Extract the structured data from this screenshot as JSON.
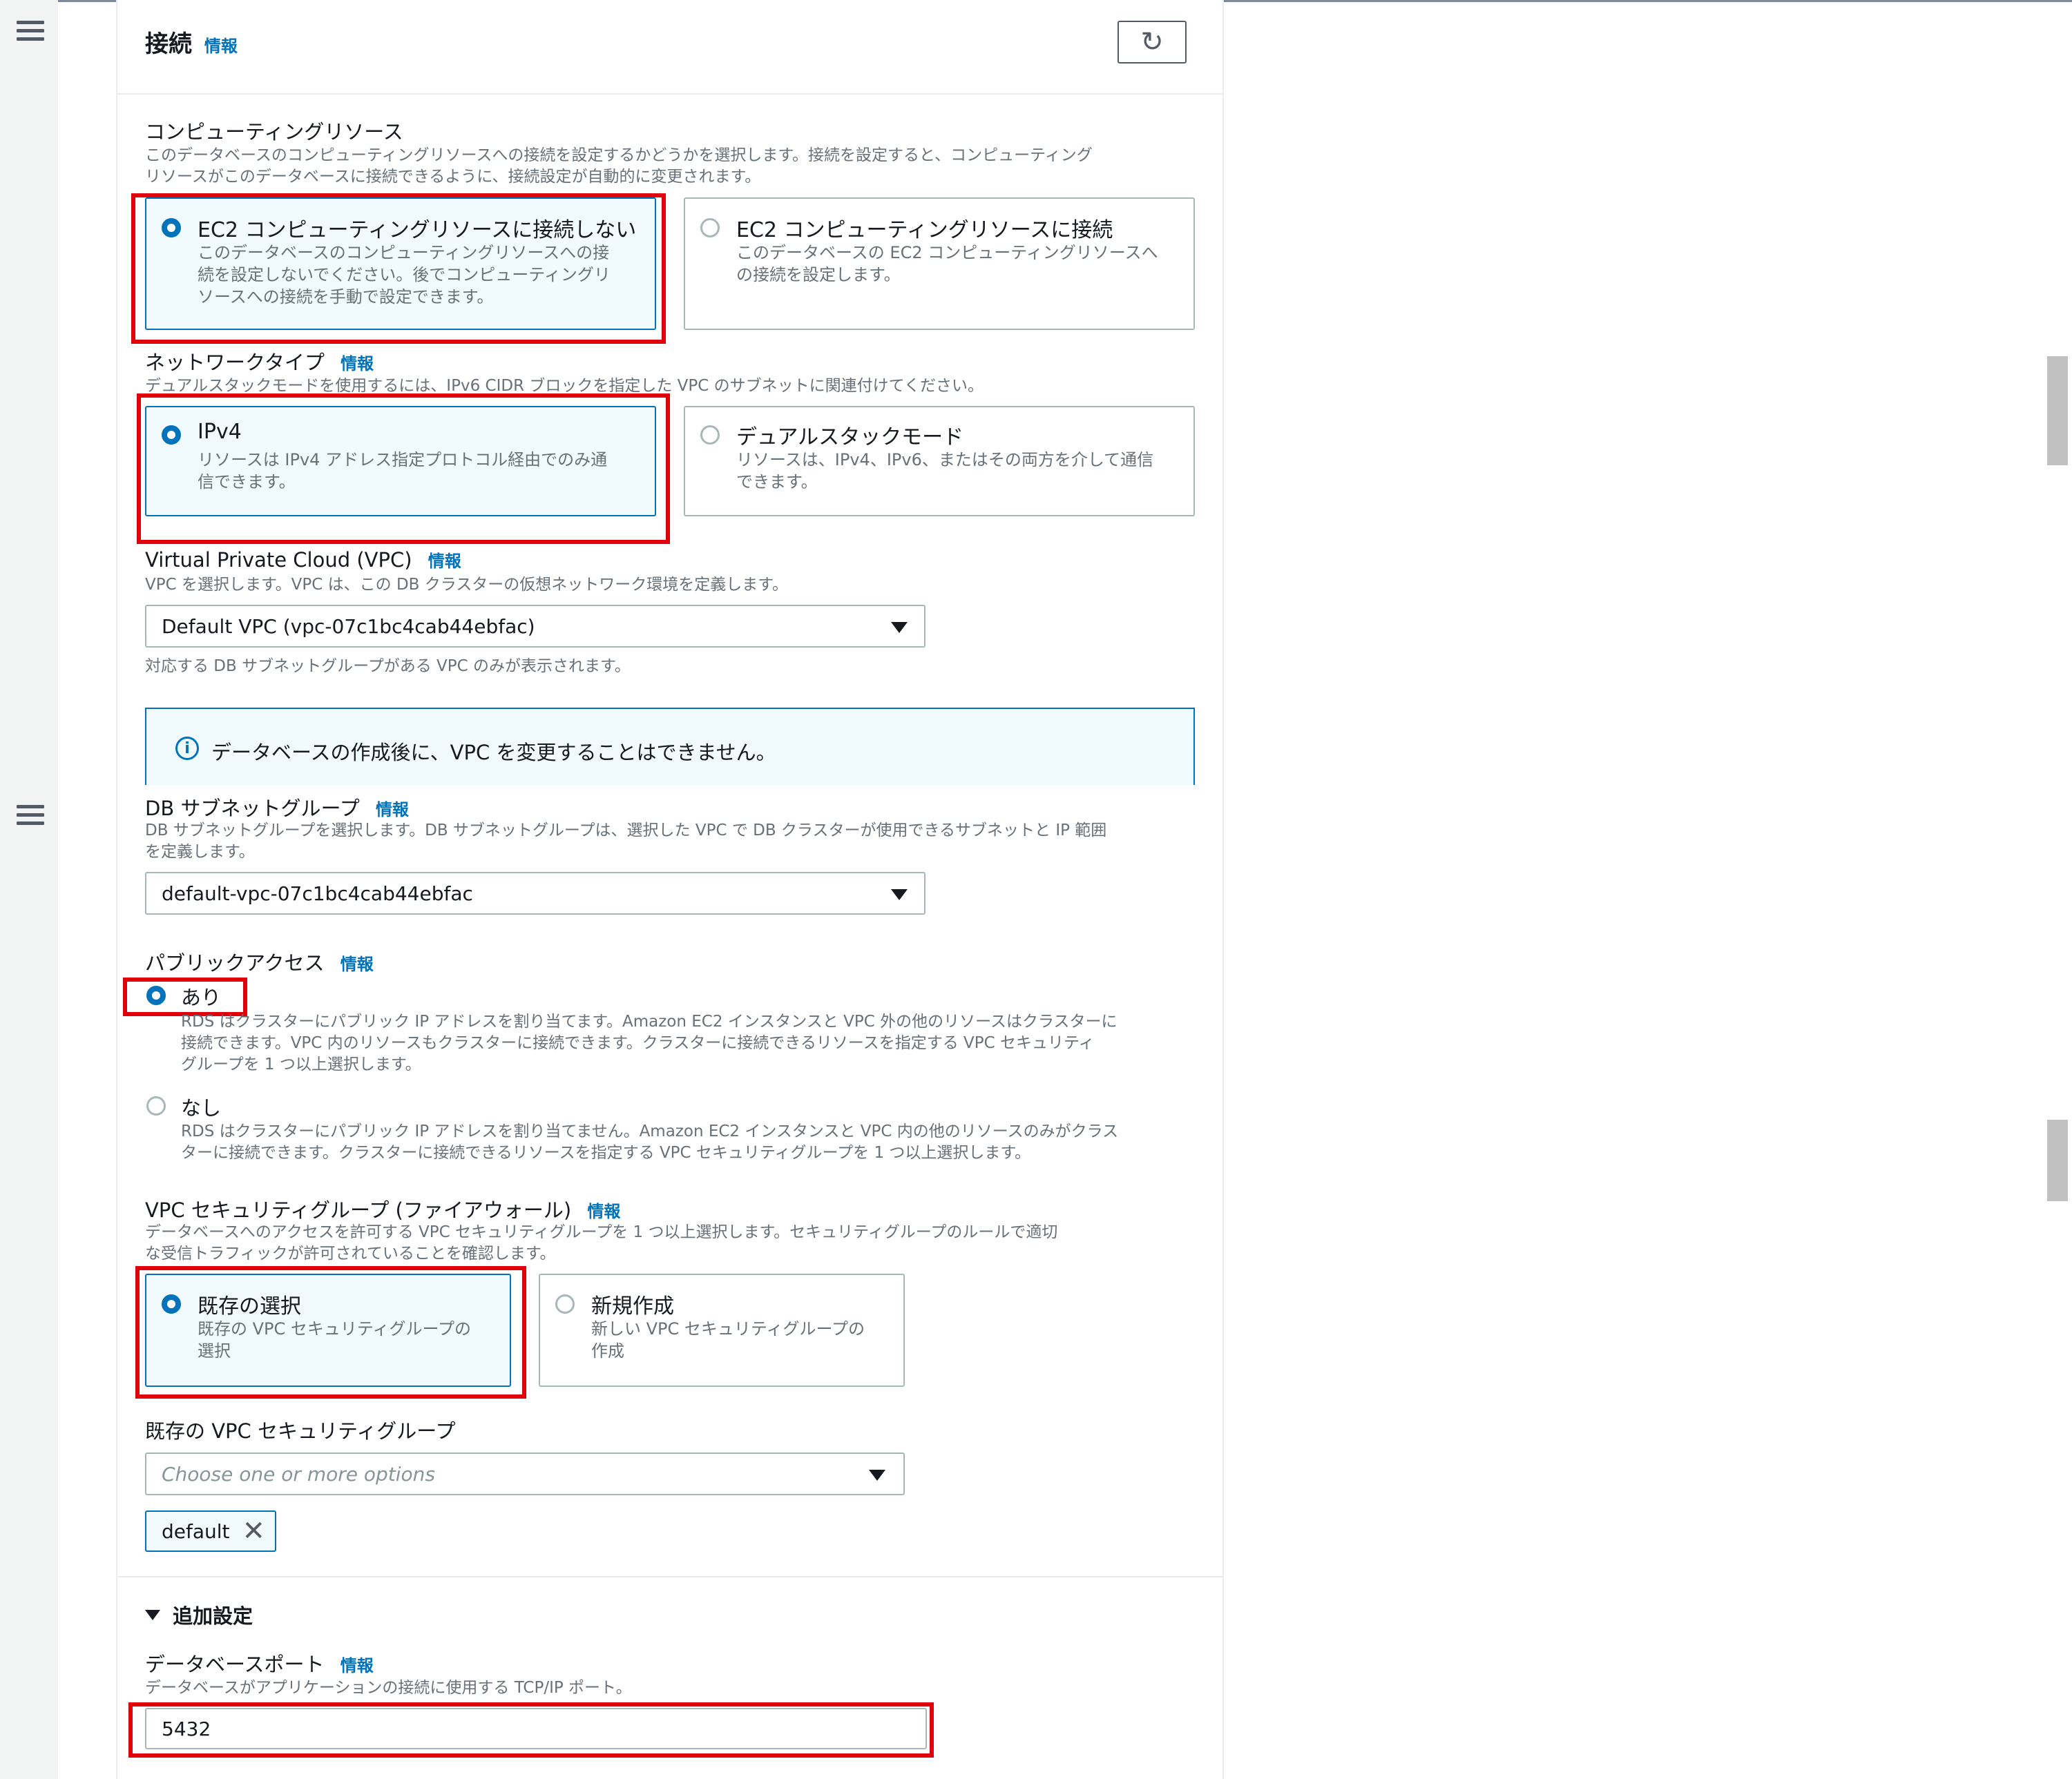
{
  "section": {
    "title": "接続",
    "info_label": "情報",
    "refresh_icon": "refresh-icon"
  },
  "compute": {
    "label": "コンピューティングリソース",
    "desc_line1": "このデータベースのコンピューティングリソースへの接続を設定するかどうかを選択します。接続を設定すると、コンピューティング",
    "desc_line2": "リソースがこのデータベースに接続できるように、接続設定が自動的に変更されます。",
    "options": [
      {
        "title": "EC2 コンピューティングリソースに接続しない",
        "desc_line1": "このデータベースのコンピューティングリソースへの接",
        "desc_line2": "続を設定しないでください。後でコンピューティングリ",
        "desc_line3": "ソースへの接続を手動で設定できます。",
        "selected": true
      },
      {
        "title": "EC2 コンピューティングリソースに接続",
        "desc_line1": "このデータベースの EC2 コンピューティングリソースへ",
        "desc_line2": "の接続を設定します。",
        "selected": false
      }
    ]
  },
  "network": {
    "label": "ネットワークタイプ",
    "info_label": "情報",
    "desc": "デュアルスタックモードを使用するには、IPv6 CIDR ブロックを指定した VPC のサブネットに関連付けてください。",
    "options": [
      {
        "title": "IPv4",
        "desc_line1": "リソースは IPv4 アドレス指定プロトコル経由でのみ通",
        "desc_line2": "信できます。",
        "selected": true
      },
      {
        "title": "デュアルスタックモード",
        "desc_line1": "リソースは、IPv4、IPv6、またはその両方を介して通信",
        "desc_line2": "できます。",
        "selected": false
      }
    ]
  },
  "vpc": {
    "label": "Virtual Private Cloud (VPC)",
    "info_label": "情報",
    "desc": "VPC を選択します。VPC は、この DB クラスターの仮想ネットワーク環境を定義します。",
    "value": "Default VPC (vpc-07c1bc4cab44ebfac)",
    "hint": "対応する DB サブネットグループがある VPC のみが表示されます。",
    "alert": "データベースの作成後に、VPC を変更することはできません。"
  },
  "subnet": {
    "label": "DB サブネットグループ",
    "info_label": "情報",
    "desc_line1": "DB サブネットグループを選択します。DB サブネットグループは、選択した VPC で DB クラスターが使用できるサブネットと IP 範囲",
    "desc_line2": "を定義します。",
    "value": "default-vpc-07c1bc4cab44ebfac"
  },
  "public": {
    "label": "パブリックアクセス",
    "info_label": "情報",
    "yes_label": "あり",
    "yes_desc_line1": "RDS はクラスターにパブリック IP アドレスを割り当てます。Amazon EC2 インスタンスと VPC 外の他のリソースはクラスターに",
    "yes_desc_line2": "接続できます。VPC 内のリソースもクラスターに接続できます。クラスターに接続できるリソースを指定する VPC セキュリティ",
    "yes_desc_line3": "グループを 1 つ以上選択します。",
    "no_label": "なし",
    "no_desc_line1": "RDS はクラスターにパブリック IP アドレスを割り当てません。Amazon EC2 インスタンスと VPC 内の他のリソースのみがクラス",
    "no_desc_line2": "ターに接続できます。クラスターに接続できるリソースを指定する VPC セキュリティグループを 1 つ以上選択します。"
  },
  "sg": {
    "label": "VPC セキュリティグループ (ファイアウォール)",
    "info_label": "情報",
    "desc_line1": "データベースへのアクセスを許可する VPC セキュリティグループを 1 つ以上選択します。セキュリティグループのルールで適切",
    "desc_line2": "な受信トラフィックが許可されていることを確認します。",
    "options": [
      {
        "title": "既存の選択",
        "desc_line1": "既存の VPC セキュリティグループの",
        "desc_line2": "選択",
        "selected": true
      },
      {
        "title": "新規作成",
        "desc_line1": "新しい VPC セキュリティグループの",
        "desc_line2": "作成",
        "selected": false
      }
    ],
    "existing_label": "既存の VPC セキュリティグループ",
    "placeholder": "Choose one or more options",
    "token": "default"
  },
  "additional": {
    "label": "追加設定",
    "port_label": "データベースポート",
    "info_label": "情報",
    "port_desc": "データベースがアプリケーションの接続に使用する TCP/IP ポート。",
    "port_value": "5432"
  },
  "colors": {
    "accent": "#0073bb",
    "highlight": "#e0000b",
    "selected_bg": "#f1faff"
  }
}
